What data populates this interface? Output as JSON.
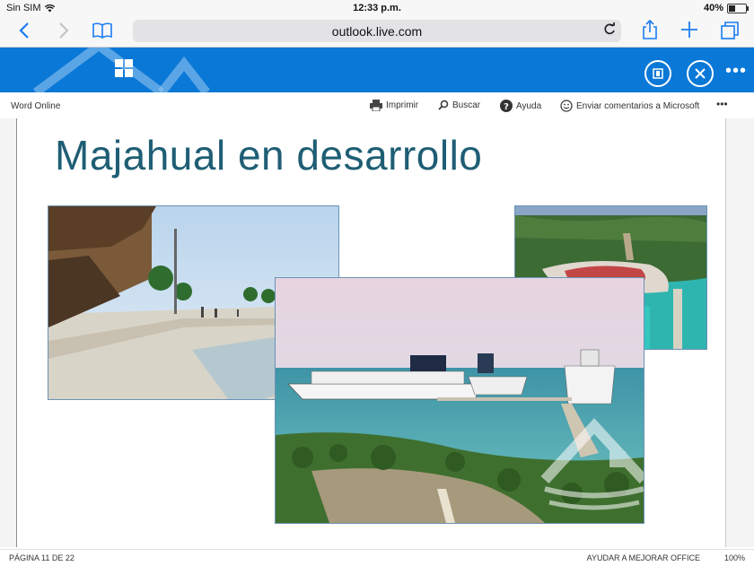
{
  "status": {
    "carrier": "Sin SIM",
    "time": "12:33 p.m.",
    "battery": "40%",
    "battery_level": 0.4
  },
  "browser": {
    "url": "outlook.live.com"
  },
  "office": {
    "app_name": "Word Online"
  },
  "toolbar": {
    "print": "Imprimir",
    "find": "Buscar",
    "help": "Ayuda",
    "feedback": "Enviar comentarios a Microsoft"
  },
  "slide": {
    "title": "Majahual en desarrollo"
  },
  "footer": {
    "page": "PÁGINA 11 DE 22",
    "improve": "AYUDAR A MEJORAR OFFICE",
    "zoom": "100%"
  },
  "icons": {
    "back": "chevron-left-icon",
    "forward": "chevron-right-icon",
    "bookmarks": "open-book-icon",
    "reload": "reload-icon",
    "share": "share-icon",
    "new_tab": "plus-icon",
    "tabs": "tabs-icon",
    "waffle": "app-launcher-icon",
    "reading_view": "reading-view-icon",
    "close": "close-icon",
    "more": "more-icon",
    "print": "printer-icon",
    "search": "search-icon",
    "help": "help-icon",
    "feedback": "smiley-icon"
  },
  "colors": {
    "office_blue": "#0a78d7",
    "safari_blue": "#1a7cf2",
    "title_teal": "#1f5e74"
  }
}
